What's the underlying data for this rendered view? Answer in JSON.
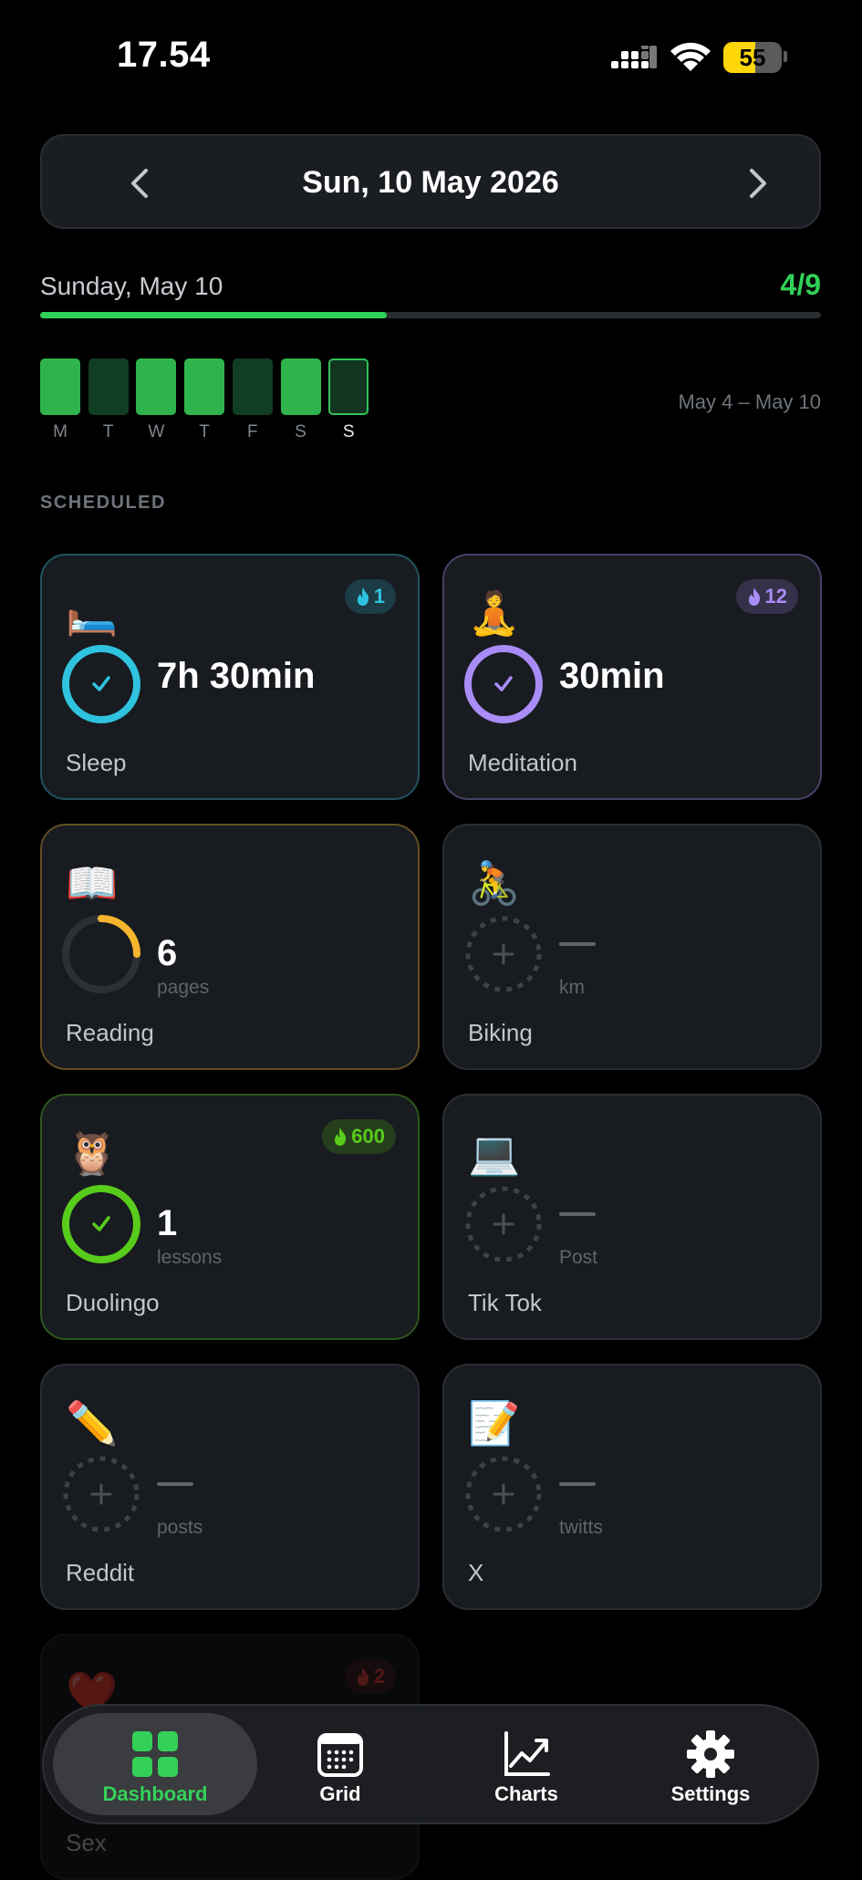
{
  "status": {
    "time": "17.54",
    "battery": "55",
    "battery_level": 0.55
  },
  "date_nav": {
    "title": "Sun, 10 May 2026"
  },
  "day": {
    "label": "Sunday, May 10",
    "count": "4/9",
    "progress": 0.444
  },
  "week": {
    "days": [
      "M",
      "T",
      "W",
      "T",
      "F",
      "S",
      "S"
    ],
    "states": [
      "on",
      "off",
      "on",
      "on",
      "off",
      "on",
      "today"
    ],
    "range": "May 4 – May 10"
  },
  "section_title": "SCHEDULED",
  "habits": [
    {
      "name": "Sleep",
      "emoji": "🛏️",
      "value": "7h 30min",
      "unit": "",
      "streak": "1",
      "color": "#2fc3e0",
      "state": "done"
    },
    {
      "name": "Meditation",
      "emoji": "🧘",
      "value": "30min",
      "unit": "",
      "streak": "12",
      "color": "#a98cf6",
      "state": "done"
    },
    {
      "name": "Reading",
      "emoji": "📖",
      "value": "6",
      "unit": "pages",
      "streak": "",
      "color": "#f5b52e",
      "state": "partial",
      "fraction": 0.25
    },
    {
      "name": "Biking",
      "emoji": "🚴",
      "value": "",
      "unit": "km",
      "streak": "",
      "color": "#5f656c",
      "state": "empty"
    },
    {
      "name": "Duolingo",
      "emoji": "🦉",
      "value": "1",
      "unit": "lessons",
      "streak": "600",
      "color": "#58cc1b",
      "state": "done"
    },
    {
      "name": "Tik Tok",
      "emoji": "💻",
      "value": "",
      "unit": "Post",
      "streak": "",
      "color": "#5f656c",
      "state": "empty"
    },
    {
      "name": "Reddit",
      "emoji": "✏️",
      "value": "",
      "unit": "posts",
      "streak": "",
      "color": "#5f656c",
      "state": "empty"
    },
    {
      "name": "X",
      "emoji": "📝",
      "value": "",
      "unit": "twitts",
      "streak": "",
      "color": "#5f656c",
      "state": "empty"
    },
    {
      "name": "Sex",
      "emoji": "❤️",
      "value": "",
      "unit": "",
      "streak": "2",
      "color": "#e5483f",
      "state": "hidden"
    }
  ],
  "tabs": [
    {
      "label": "Dashboard",
      "icon": "dashboard-icon",
      "active": true
    },
    {
      "label": "Grid",
      "icon": "calendar-grid-icon",
      "active": false
    },
    {
      "label": "Charts",
      "icon": "chart-line-icon",
      "active": false
    },
    {
      "label": "Settings",
      "icon": "gear-icon",
      "active": false
    }
  ],
  "colors": {
    "accent": "#30d158",
    "background": "#000000",
    "card": "#181b20"
  }
}
